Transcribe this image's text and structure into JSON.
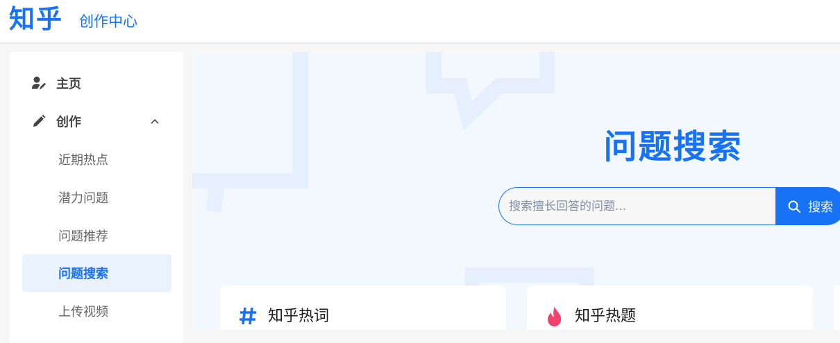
{
  "header": {
    "logo": "知乎",
    "subtitle": "创作中心"
  },
  "sidebar": {
    "items": [
      {
        "label": "主页",
        "icon": "user-edit-icon"
      },
      {
        "label": "创作",
        "icon": "pencil-icon",
        "expanded": true
      }
    ],
    "sub_items": [
      {
        "label": "近期热点",
        "active": false
      },
      {
        "label": "潜力问题",
        "active": false
      },
      {
        "label": "问题推荐",
        "active": false
      },
      {
        "label": "问题搜索",
        "active": true
      },
      {
        "label": "上传视频",
        "active": false
      }
    ]
  },
  "main": {
    "title": "问题搜索",
    "search": {
      "placeholder": "搜索擅长回答的问题...",
      "value": "",
      "button_label": "搜索"
    },
    "cards": [
      {
        "title": "知乎热词",
        "icon": "hash-icon"
      },
      {
        "title": "知乎热题",
        "icon": "flame-icon"
      }
    ]
  },
  "colors": {
    "brand": "#1772f6",
    "active_bg": "#eaf2fe",
    "main_bg": "#f3f7fe",
    "flame": "#f1416c"
  }
}
